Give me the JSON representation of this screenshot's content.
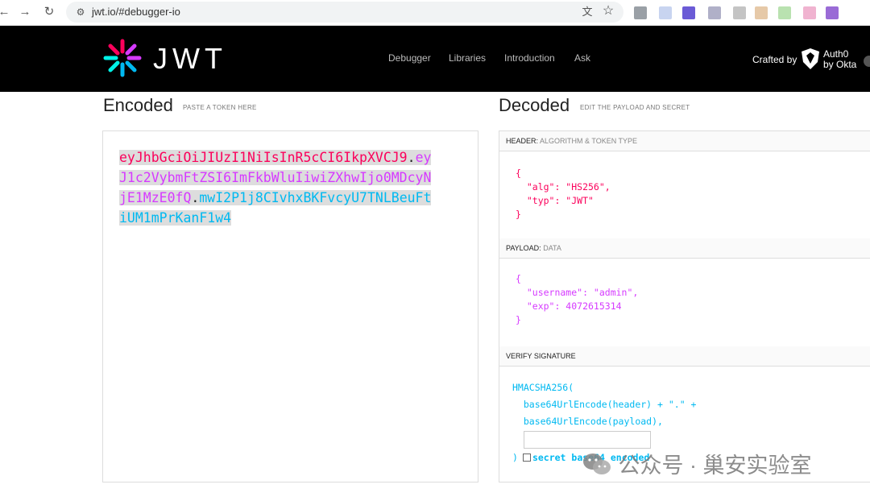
{
  "browser": {
    "url": "jwt.io/#debugger-io",
    "back_icon": "arrow-left-icon",
    "forward_icon": "arrow-right-icon",
    "reload_icon": "reload-icon",
    "site_info_icon": "tune-icon",
    "translate_icon": "translate-icon",
    "bookmark_icon": "star-icon",
    "extension_colors": [
      "#9aa0a6",
      "#c8d4f0",
      "#6b5bd6",
      "#b0b0c8",
      "#c4c4c4",
      "#e6c9a8",
      "#b9e2b0",
      "#f0b3d0",
      "#9a6bd6"
    ]
  },
  "header": {
    "logo_text": "JWT",
    "nav": [
      "Debugger",
      "Libraries",
      "Introduction",
      "Ask"
    ],
    "crafted_by": "Crafted by",
    "auth0_line1": "Auth0",
    "auth0_line2": "by Okta"
  },
  "encoded": {
    "title": "Encoded",
    "subtitle": "PASTE A TOKEN HERE",
    "token_header": "eyJhbGciOiJIUzI1NiIsInR5cCI6IkpXVCJ9",
    "token_payload": "eyJ1c2VybmFtZSI6ImFkbWluIiwiZXhwIjo0MDcyNjE1MzE0fQ",
    "token_signature": "mwI2P1j8CIvhxBKFvcyU7TNLBeuFtiUM1mPrKanF1w4",
    "dot": "."
  },
  "decoded": {
    "title": "Decoded",
    "subtitle": "EDIT THE PAYLOAD AND SECRET",
    "header_label": "HEADER:",
    "header_sub": "ALGORITHM & TOKEN TYPE",
    "header_json": "{\n  \"alg\": \"HS256\",\n  \"typ\": \"JWT\"\n}",
    "payload_label": "PAYLOAD:",
    "payload_sub": "DATA",
    "payload_json": "{\n  \"username\": \"admin\",\n  \"exp\": 4072615314\n}",
    "verify_label": "VERIFY SIGNATURE",
    "verify_code": "HMACSHA256(\n  base64UrlEncode(header) + \".\" +\n  base64UrlEncode(payload),",
    "secret_value": "",
    "close_paren": ")",
    "secret_label": "secret base64 encoded"
  },
  "watermark": {
    "icon": "wechat-icon",
    "text": "公众号 · 巢安实验室"
  },
  "colors": {
    "header": "#fb015b",
    "payload": "#d63aff",
    "signature": "#00b9f1"
  }
}
